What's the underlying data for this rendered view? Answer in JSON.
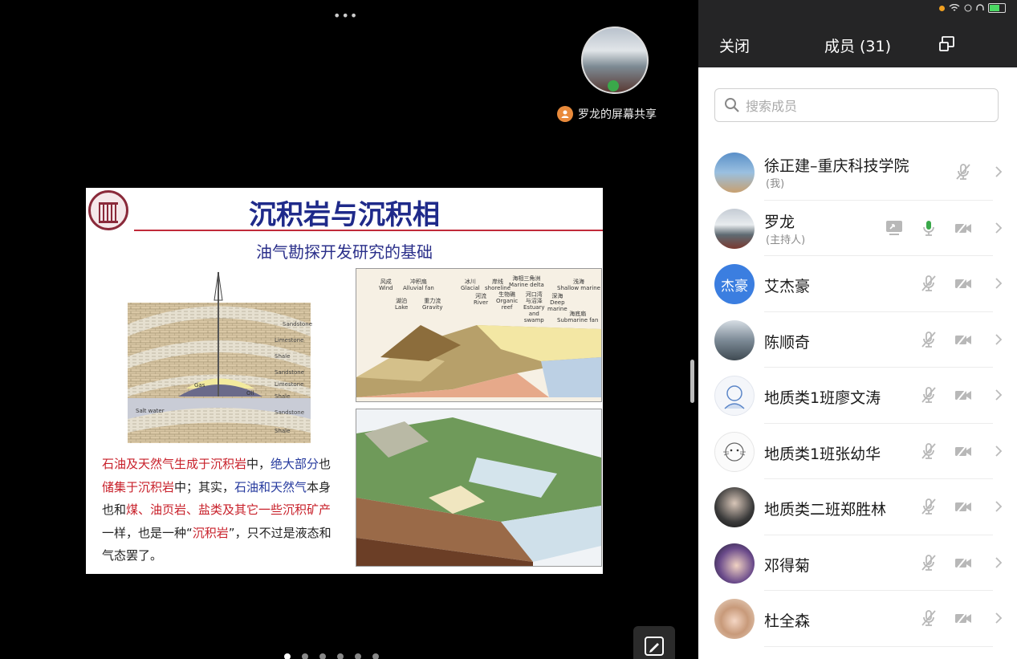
{
  "share": {
    "presenter_label": "罗龙的屏幕共享"
  },
  "slide": {
    "title": "沉积岩与沉积相",
    "subtitle": "油气勘探开发研究的基础",
    "diagram_labels": {
      "layers": [
        "Sandstone",
        "Limestone",
        "Shale",
        "Sandstone",
        "Limestone",
        "Shale",
        "Sandstone",
        "Shale"
      ],
      "gas": "Gas",
      "oil": "Oil",
      "salt_water": "Salt water"
    },
    "map_top_labels": [
      "风成\nWind",
      "冲积扇\nAlluvial fan",
      "湖泊\nLake",
      "重力流\nGravity",
      "冰川\nGlacial",
      "岸线\nshoreline",
      "海相三角洲\nMarine delta",
      "浅海\nShallow marine",
      "河流\nRiver",
      "生物礁\nOrganic\nreef",
      "河口湾\n与沼泽\nEstuary\nand\nswamp",
      "深海\nDeep\nmarine",
      "海底扇\nSubmarine fan"
    ],
    "paragraph": [
      {
        "t": "石油及天然气生成于沉积岩",
        "c": "r"
      },
      {
        "t": "中，",
        "c": ""
      },
      {
        "t": "绝大部分",
        "c": "b"
      },
      {
        "t": "也",
        "c": ""
      },
      {
        "t": "储集于沉积岩",
        "c": "r"
      },
      {
        "t": "中；其实，",
        "c": ""
      },
      {
        "t": "石油和天然气",
        "c": "b"
      },
      {
        "t": "本身也和",
        "c": ""
      },
      {
        "t": "煤、油页岩、盐类及其它一些沉积矿产",
        "c": "r"
      },
      {
        "t": "一样，也是一种“",
        "c": ""
      },
      {
        "t": "沉积岩",
        "c": "r"
      },
      {
        "t": "”，只不过是液态和气态罢了。",
        "c": ""
      }
    ]
  },
  "panel": {
    "close_label": "关闭",
    "title": "成员 (31)",
    "search_placeholder": "搜索成员",
    "members": [
      {
        "name": "徐正建–重庆科技学院",
        "role": "(我)",
        "avatar": "photo-sky",
        "screen": false,
        "mic": "muted",
        "cam": false
      },
      {
        "name": "罗龙",
        "role": "(主持人)",
        "avatar": "photo-lake",
        "screen": true,
        "mic": "active",
        "cam": "off"
      },
      {
        "name": "艾杰豪",
        "role": "",
        "avatar_text": "杰豪",
        "avatar": "text-blue",
        "screen": false,
        "mic": "muted",
        "cam": "off"
      },
      {
        "name": "陈顺奇",
        "role": "",
        "avatar": "photo-city",
        "screen": false,
        "mic": "muted",
        "cam": "off"
      },
      {
        "name": "地质类1班廖文涛",
        "role": "",
        "avatar": "drawing-blue",
        "screen": false,
        "mic": "muted",
        "cam": "off"
      },
      {
        "name": "地质类1班张幼华",
        "role": "",
        "avatar": "drawing-cat",
        "screen": false,
        "mic": "muted",
        "cam": "off"
      },
      {
        "name": "地质类二班郑胜林",
        "role": "",
        "avatar": "photo-dark",
        "screen": false,
        "mic": "muted",
        "cam": "off"
      },
      {
        "name": "邓得菊",
        "role": "",
        "avatar": "photo-cartoon",
        "screen": false,
        "mic": "muted",
        "cam": "off"
      },
      {
        "name": "杜全森",
        "role": "",
        "avatar": "photo-child",
        "screen": false,
        "mic": "muted",
        "cam": "off"
      }
    ]
  },
  "colors": {
    "panel_header": "#252526",
    "mic_active": "#3aa84a",
    "muted_icon": "#b8b8b8",
    "slide_title": "#1f2a8a",
    "slide_red": "#c8202a"
  }
}
